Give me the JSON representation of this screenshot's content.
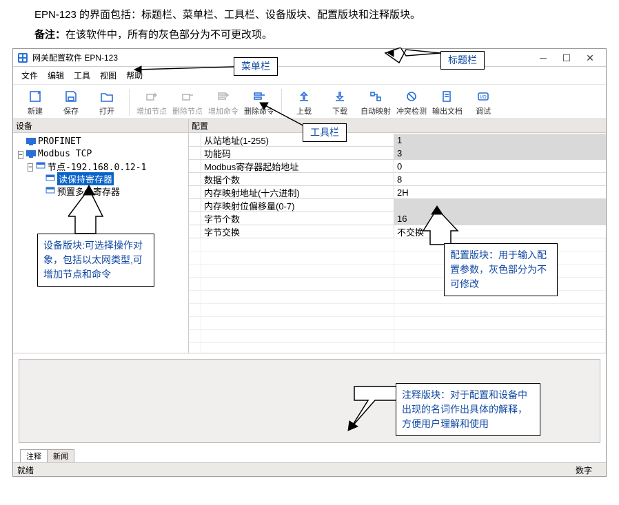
{
  "doc": {
    "intro": "EPN-123 的界面包括：标题栏、菜单栏、工具栏、设备版块、配置版块和注释版块。",
    "note_label": "备注：",
    "note_text": "在该软件中，所有的灰色部分为不可更改项。"
  },
  "window": {
    "title": "网关配置软件 EPN-123"
  },
  "menu": {
    "file": "文件",
    "edit": "编辑",
    "tool": "工具",
    "view": "视图",
    "help": "帮助"
  },
  "toolbar": {
    "new": "新建",
    "save": "保存",
    "open": "打开",
    "add_node": "增加节点",
    "del_node": "删除节点",
    "add_cmd": "增加命令",
    "del_cmd": "删除命令",
    "upload": "上载",
    "download": "下载",
    "auto_map": "自动映射",
    "conflict": "冲突检测",
    "export": "输出文档",
    "debug": "调试"
  },
  "panels": {
    "device": "设备",
    "config": "配置"
  },
  "tree": {
    "profinet": "PROFINET",
    "modbus": "Modbus TCP",
    "node1": "节点-192.168.0.12-1",
    "cmd1": "读保持寄存器",
    "cmd2": "预置多个寄存器"
  },
  "config_rows": [
    {
      "label": "从站地址(1-255)",
      "value": "1",
      "readonly": true
    },
    {
      "label": "功能码",
      "value": "3",
      "readonly": true
    },
    {
      "label": "Modbus寄存器起始地址",
      "value": "0",
      "readonly": false
    },
    {
      "label": "数据个数",
      "value": "8",
      "readonly": false
    },
    {
      "label": "内存映射地址(十六进制)",
      "value": "2H",
      "readonly": false
    },
    {
      "label": "内存映射位偏移量(0-7)",
      "value": "",
      "readonly": true
    },
    {
      "label": "字节个数",
      "value": "16",
      "readonly": true
    },
    {
      "label": "字节交换",
      "value": "不交换",
      "readonly": false
    }
  ],
  "callouts": {
    "titlebar": "标题栏",
    "menubar": "菜单栏",
    "toolbar": "工具栏",
    "device": "设备版块:可选择操作对象，包括以太网类型,可增加节点和命令",
    "config": "配置版块：用于输入配置参数，灰色部分为不可修改",
    "comment": "注释版块：对于配置和设备中出现的名词作出具体的解释，方便用户理解和使用"
  },
  "tabs": {
    "comment": "注释",
    "news": "新闻"
  },
  "status": {
    "ready": "就绪",
    "numlock": "数字"
  }
}
